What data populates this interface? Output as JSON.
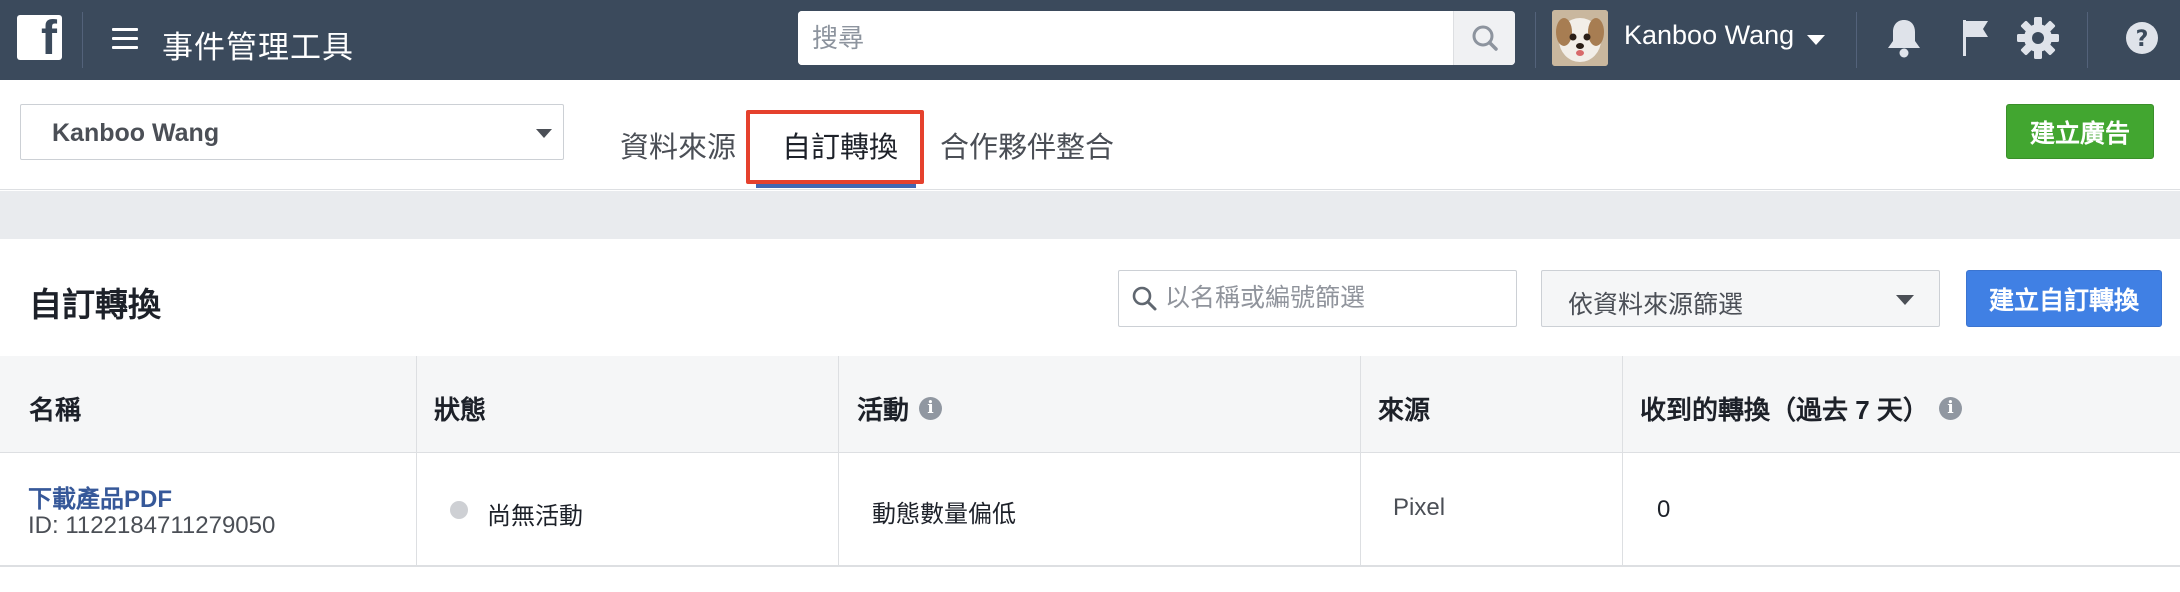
{
  "topbar": {
    "app_title": "事件管理工具",
    "search_placeholder": "搜尋",
    "user_name": "Kanboo Wang"
  },
  "subbar": {
    "account_name": "Kanboo Wang",
    "tabs": [
      {
        "label": "資料來源",
        "active": false
      },
      {
        "label": "自訂轉換",
        "active": true
      },
      {
        "label": "合作夥伴整合",
        "active": false
      }
    ],
    "create_ad_label": "建立廣告"
  },
  "panel": {
    "title": "自訂轉換",
    "filter_placeholder": "以名稱或編號篩選",
    "source_filter_label": "依資料來源篩選",
    "create_button_label": "建立自訂轉換"
  },
  "table": {
    "columns": [
      "名稱",
      "狀態",
      "活動",
      "來源",
      "收到的轉換（過去 7 天）"
    ],
    "rows": [
      {
        "name": "下載產品PDF",
        "id": "ID: 1122184711279050",
        "status": "尚無活動",
        "activity": "動態數量偏低",
        "source": "Pixel",
        "conversions": "0"
      }
    ]
  },
  "colors": {
    "topbar": "#3b4a5c",
    "create_ad": "#42a630",
    "primary": "#4080e4",
    "link": "#365899",
    "highlight": "#e5412d"
  }
}
